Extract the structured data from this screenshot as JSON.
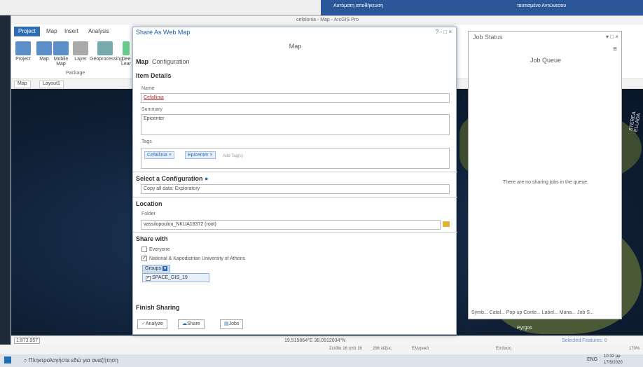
{
  "word": {
    "doc_title": "Αυτόματη αποθήκευση",
    "file": "cefalonia - Map - ArcGIS Pro",
    "user": "ταυτισμένο Αντώνεσου"
  },
  "ribbon": {
    "tabs": [
      "Project",
      "Map",
      "Insert",
      "Analysis"
    ],
    "buttons": [
      "Project",
      "Map",
      "Mobile Map",
      "Layer",
      "Geoprocessing",
      "Dee Lear"
    ],
    "group_label": "Package"
  },
  "view_tabs": [
    "Map",
    "Layout1"
  ],
  "status": {
    "scale": "1:873.957",
    "coords": "19,515864°E 38,0912034°N"
  },
  "share": {
    "title": "Share As Web Map",
    "controls": "? - □ ×",
    "subtitle": "Map",
    "tabs": {
      "map": "Map",
      "config": "Configuration"
    },
    "item_details": "Item Details",
    "name_label": "Name",
    "name_value": "Cefallinia",
    "summary_label": "Summary",
    "summary_value": "Epicenter",
    "tags_label": "Tags",
    "tags": [
      "Cefallinia ×",
      "Epicenter ×"
    ],
    "tag_placeholder": "Add Tag(s)",
    "config_heading": "Select a Configuration",
    "config_value": "Copy all data: Exploratory",
    "location_heading": "Location",
    "folder_label": "Folder",
    "folder_value": "vassilopoulou_NKUA18372 (root)",
    "share_heading": "Share with",
    "everyone": "Everyone",
    "org": "National & Kapodistrian University of Athens",
    "groups": "Groups",
    "group_item": "SPACE_GIS_19",
    "finish": "Finish Sharing",
    "analyze": "Analyze",
    "share_btn": "Share",
    "jobs_btn": "Jobs"
  },
  "job": {
    "title": "Job Status",
    "controls": "▾ □ ×",
    "queue": "Job Queue",
    "empty": "There are no sharing jobs in the queue.",
    "tabs": "Symb...  Catal...  Pop-up  Conte...  Label...  Mana...  Job S..."
  },
  "map_labels": {
    "pyrgos": "Pyrgos",
    "sterea": "STEREA ELLADA"
  },
  "selected_features": "Selected Features: 0",
  "wordstatus": {
    "page": "Σελίδα 16 από 16",
    "words": "296 λέξεις",
    "lang": "Ελληνικά",
    "focus": "Εστίαση",
    "zoom": "170%"
  },
  "taskbar": {
    "search": "Πληκτρολογήστε εδώ για αναζήτηση",
    "lang": "ENG",
    "time": "10:32 μμ",
    "date": "17/5/2020"
  }
}
